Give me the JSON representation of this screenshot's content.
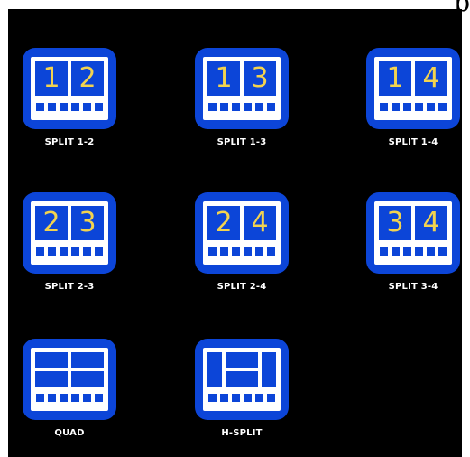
{
  "header": {
    "glyph": "p"
  },
  "colors": {
    "background": "#000000",
    "icon": "#0c45d8",
    "screen": "#ffffff",
    "digit": "#f3d34f",
    "label": "#ffffff"
  },
  "layouts": [
    {
      "id": "split-1-2",
      "label": "SPLIT 1-2",
      "panes": [
        "1",
        "2"
      ]
    },
    {
      "id": "split-1-3",
      "label": "SPLIT 1-3",
      "panes": [
        "1",
        "3"
      ]
    },
    {
      "id": "split-1-4",
      "label": "SPLIT 1-4",
      "panes": [
        "1",
        "4"
      ]
    },
    {
      "id": "split-2-3",
      "label": "SPLIT 2-3",
      "panes": [
        "2",
        "3"
      ]
    },
    {
      "id": "split-2-4",
      "label": "SPLIT 2-4",
      "panes": [
        "2",
        "4"
      ]
    },
    {
      "id": "split-3-4",
      "label": "SPLIT 3-4",
      "panes": [
        "3",
        "4"
      ]
    },
    {
      "id": "quad",
      "label": "QUAD",
      "panes": []
    },
    {
      "id": "h-split",
      "label": "H-SPLIT",
      "panes": []
    }
  ]
}
